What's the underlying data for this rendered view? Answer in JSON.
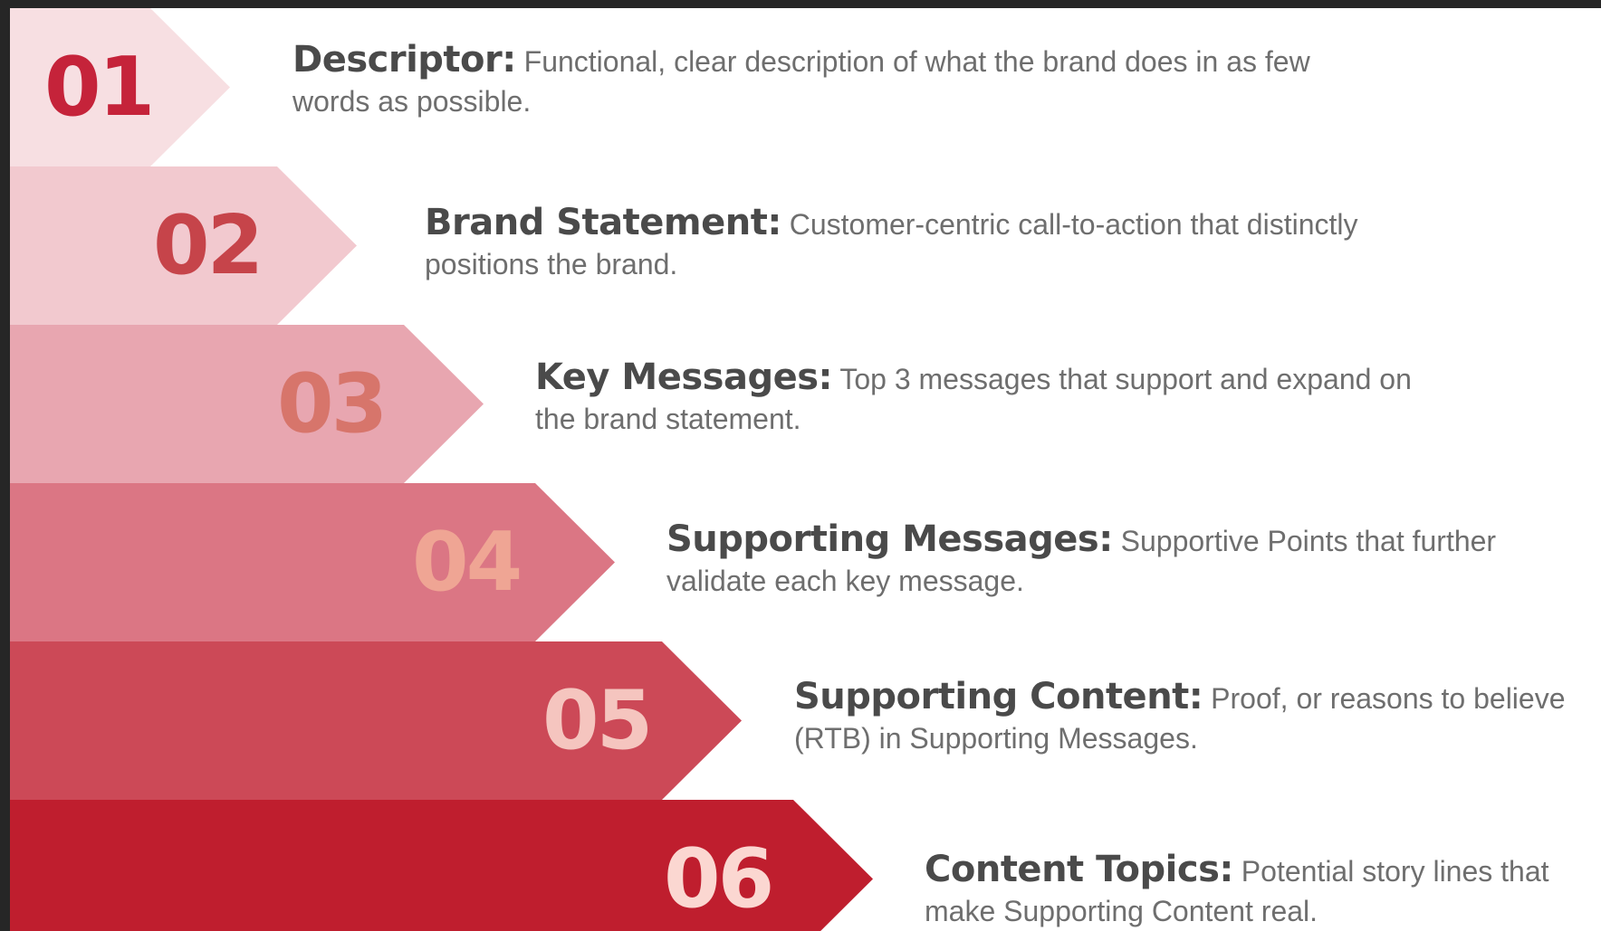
{
  "steps": [
    {
      "number": "01",
      "term": "Descriptor:",
      "description": "Functional, clear description of what the brand does in as few words as possible.",
      "color": "#f7dfe2",
      "number_color": "#c5233a"
    },
    {
      "number": "02",
      "term": "Brand Statement:",
      "description": "Customer-centric call-to-action that distinctly positions the brand.",
      "color": "#f2c9cf",
      "number_color": "#c6444a"
    },
    {
      "number": "03",
      "term": "Key Messages:",
      "description": "Top 3 messages that support and expand on the brand statement.",
      "color": "#e8a6b0",
      "number_color": "#d7756b"
    },
    {
      "number": "04",
      "term": "Supporting Messages:",
      "description": "Supportive Points that further validate each key message.",
      "color": "#db7684",
      "number_color": "#efa594"
    },
    {
      "number": "05",
      "term": "Supporting Content:",
      "description": "Proof, or reasons to believe (RTB) in Supporting Messages.",
      "color": "#cc4957",
      "number_color": "#f5c5bf"
    },
    {
      "number": "06",
      "term": "Content Topics:",
      "description": "Potential story lines that make Supporting Content real.",
      "color": "#bf1e2e",
      "number_color": "#fbd7d1"
    }
  ]
}
